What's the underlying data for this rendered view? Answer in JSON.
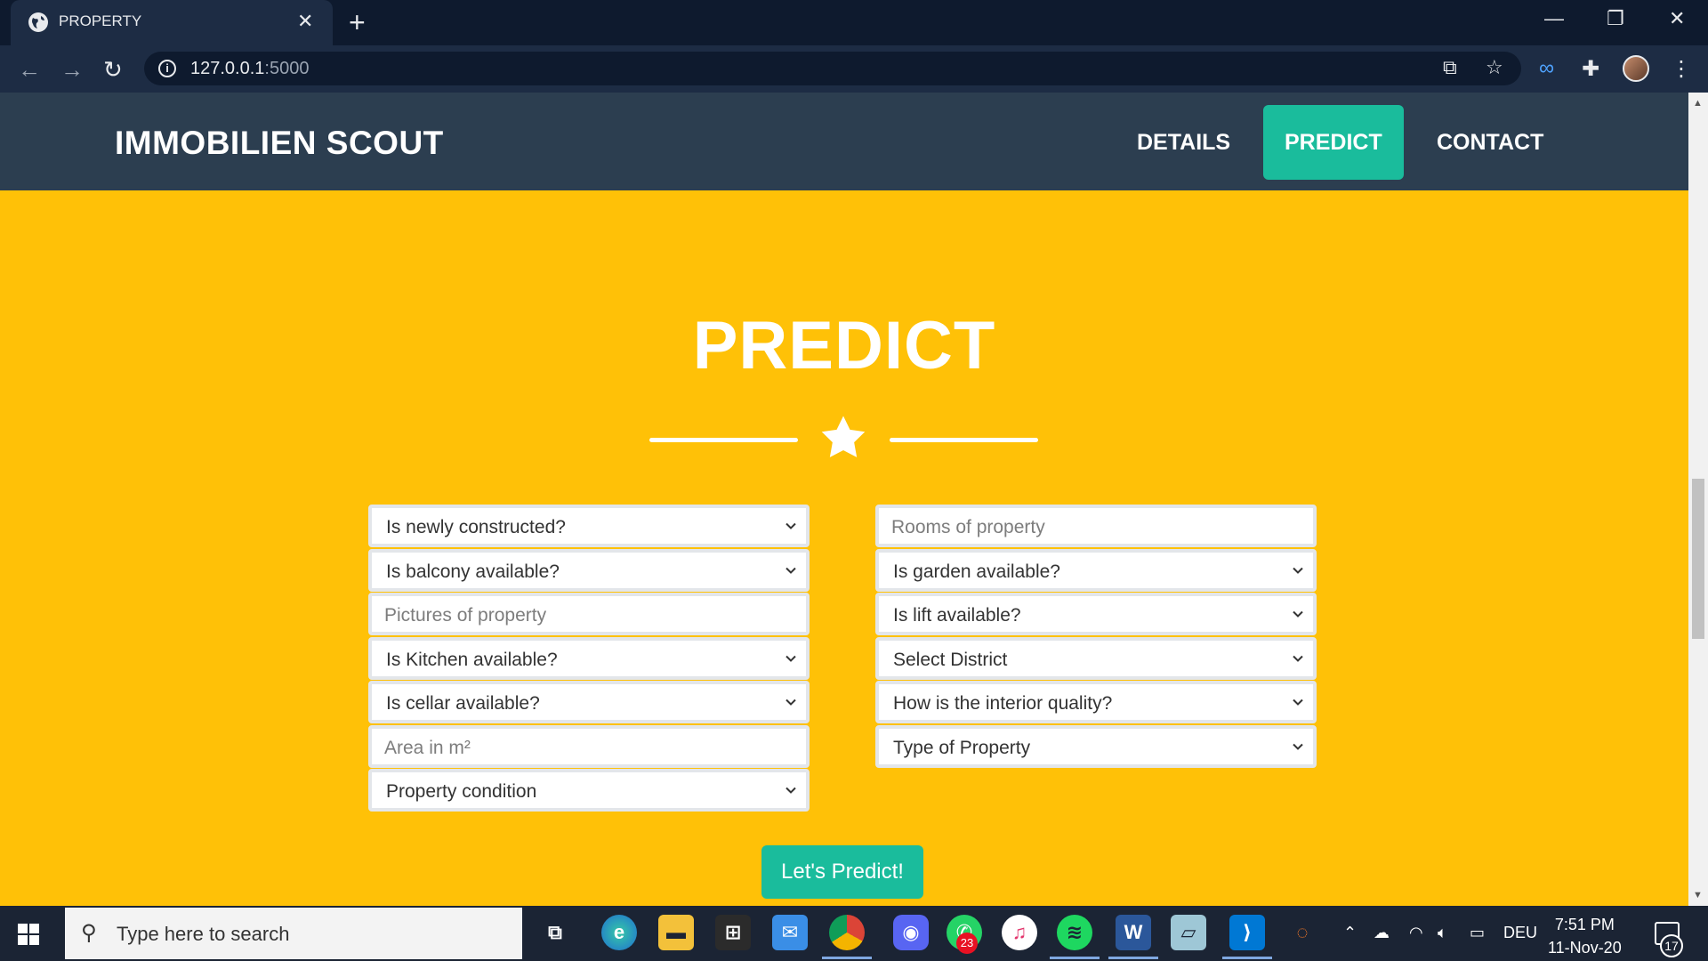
{
  "browser": {
    "tab_title": "PROPERTY",
    "tab_close": "✕",
    "new_tab": "+",
    "url_host": "127.0.0.1",
    "url_port": ":5000",
    "window_controls": {
      "minimize": "—",
      "restore": "❐",
      "close": "✕"
    }
  },
  "site": {
    "brand": "IMMOBILIEN SCOUT",
    "nav": [
      {
        "label": "DETAILS",
        "active": false
      },
      {
        "label": "PREDICT",
        "active": true
      },
      {
        "label": "CONTACT",
        "active": false
      }
    ]
  },
  "section": {
    "title": "PREDICT",
    "button": "Let's Predict!"
  },
  "form": {
    "left": [
      {
        "type": "select",
        "text": "Is newly constructed?"
      },
      {
        "type": "select",
        "text": "Is balcony available?"
      },
      {
        "type": "input",
        "text": "Pictures of property"
      },
      {
        "type": "select",
        "text": "Is Kitchen available?"
      },
      {
        "type": "select",
        "text": "Is cellar available?"
      },
      {
        "type": "input",
        "text": "Area in m²"
      },
      {
        "type": "select",
        "text": "Property condition"
      }
    ],
    "right": [
      {
        "type": "input",
        "text": "Rooms of property"
      },
      {
        "type": "select",
        "text": "Is garden available?"
      },
      {
        "type": "select",
        "text": "Is lift available?"
      },
      {
        "type": "select",
        "text": "Select District"
      },
      {
        "type": "select",
        "text": "How is the interior quality?"
      },
      {
        "type": "select",
        "text": "Type of Property"
      }
    ]
  },
  "taskbar": {
    "search_placeholder": "Type here to search",
    "whatsapp_badge": "23",
    "language": "DEU",
    "time": "7:51 PM",
    "date": "11-Nov-20",
    "notifications": "17"
  },
  "colors": {
    "page_bg": "#ffc107",
    "navbar_bg": "#2c3e50",
    "accent": "#1abc9c"
  }
}
